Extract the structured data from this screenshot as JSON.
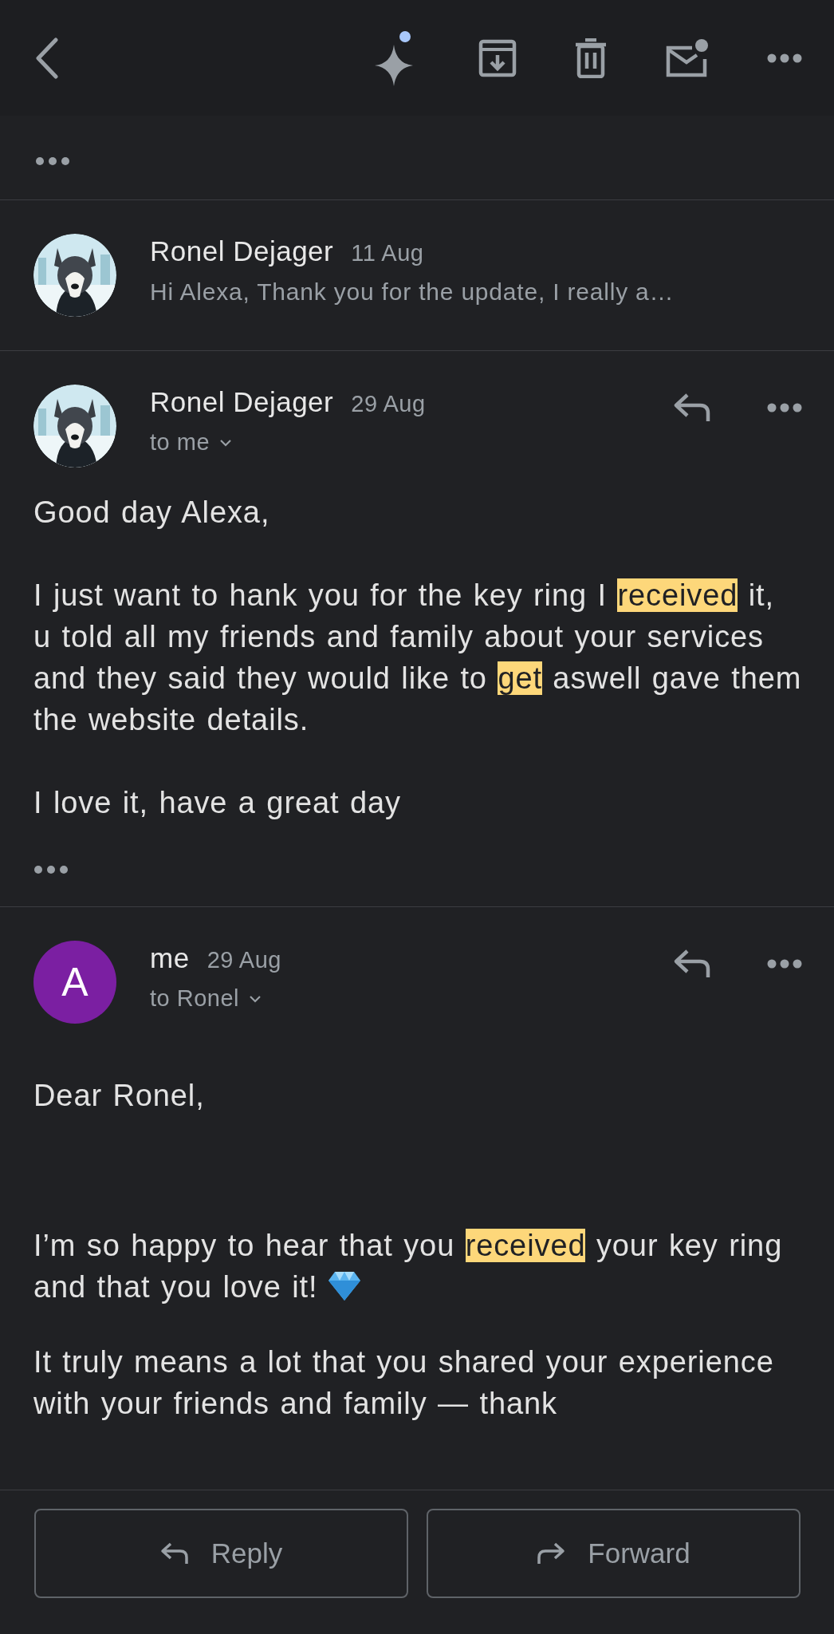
{
  "messages": [
    {
      "kind": "collapsed",
      "sender": "Ronel Dejager",
      "date": "11 Aug",
      "snippet": "Hi Alexa, Thank you for the update, I really a…"
    },
    {
      "kind": "expanded",
      "sender": "Ronel Dejager",
      "date": "29 Aug",
      "recipient": "to me",
      "trimmed": true,
      "paragraphs": [
        {
          "segments": [
            {
              "text": "Good day Alexa,",
              "highlighted": false
            }
          ],
          "trailing_icon": false
        },
        {
          "segments": [
            {
              "text": "I just want to hank you for the key ring  I ",
              "highlighted": false
            },
            {
              "text": "received",
              "highlighted": true
            },
            {
              "text": " it, u told all my friends and family about your services and they said they would like to ",
              "highlighted": false
            },
            {
              "text": "get",
              "highlighted": true
            },
            {
              "text": " aswell gave them the website details.",
              "highlighted": false
            }
          ],
          "trailing_icon": false
        },
        {
          "segments": [
            {
              "text": "I love it, have a great day",
              "highlighted": false
            }
          ],
          "trailing_icon": false
        }
      ]
    },
    {
      "kind": "expanded",
      "sender": "me",
      "date": "29 Aug",
      "recipient": "to Ronel",
      "avatar": {
        "kind": "letter",
        "letter": "A",
        "color": "#7b1fa2"
      },
      "trimmed": false,
      "paragraphs": [
        {
          "segments": [
            {
              "text": "Dear Ronel,",
              "highlighted": false
            }
          ],
          "trailing_icon": false
        },
        {
          "segments": [
            {
              "text": "I’m so happy to hear that you ",
              "highlighted": false
            },
            {
              "text": "received",
              "highlighted": true
            },
            {
              "text": " your key ring and that you love it!",
              "highlighted": false
            }
          ],
          "trailing_icon": true
        },
        {
          "segments": [
            {
              "text": "It truly means a lot that you shared your experience with your friends and family — thank",
              "highlighted": false
            }
          ],
          "trailing_icon": false
        }
      ]
    }
  ],
  "actions": [
    {
      "label": "Reply",
      "kind": "reply"
    },
    {
      "label": "Forward",
      "kind": "forward"
    }
  ]
}
